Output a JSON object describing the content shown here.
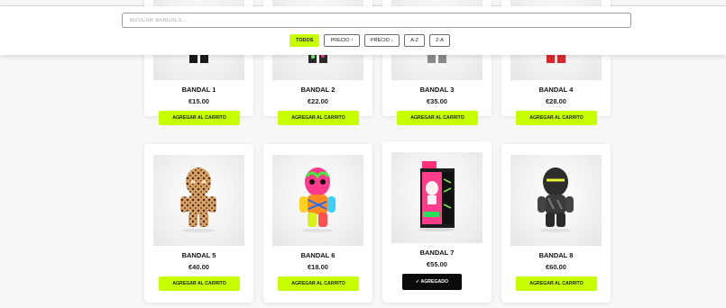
{
  "search": {
    "placeholder": "BUSCAR BANDALS..."
  },
  "filters": [
    {
      "label": "TODOS",
      "active": true
    },
    {
      "label": "PRECIO ↑",
      "active": false
    },
    {
      "label": "PRECIO ↓",
      "active": false
    },
    {
      "label": "A-Z",
      "active": false
    },
    {
      "label": "Z-A",
      "active": false
    }
  ],
  "products": [
    {
      "name": "BANDAL 1",
      "price": "€15.00",
      "button": "AGREGAR AL CARRITO",
      "added": false
    },
    {
      "name": "BANDAL 2",
      "price": "€22.00",
      "button": "AGREGAR AL CARRITO",
      "added": false
    },
    {
      "name": "BANDAL 3",
      "price": "€35.00",
      "button": "AGREGAR AL CARRITO",
      "added": false
    },
    {
      "name": "BANDAL 4",
      "price": "€28.00",
      "button": "AGREGAR AL CARRITO",
      "added": false
    },
    {
      "name": "BANDAL 5",
      "price": "€40.00",
      "button": "AGREGAR AL CARRITO",
      "added": false
    },
    {
      "name": "BANDAL 6",
      "price": "€18.00",
      "button": "AGREGAR AL CARRITO",
      "added": false
    },
    {
      "name": "BANDAL 7",
      "price": "€55.00",
      "button": "✓ AGREGADO",
      "added": true
    },
    {
      "name": "BANDAL 8",
      "price": "€60.00",
      "button": "AGREGAR AL CARRITO",
      "added": false
    }
  ],
  "colors": {
    "accent": "#c8ff00",
    "added_button": "#0b0b0b"
  }
}
